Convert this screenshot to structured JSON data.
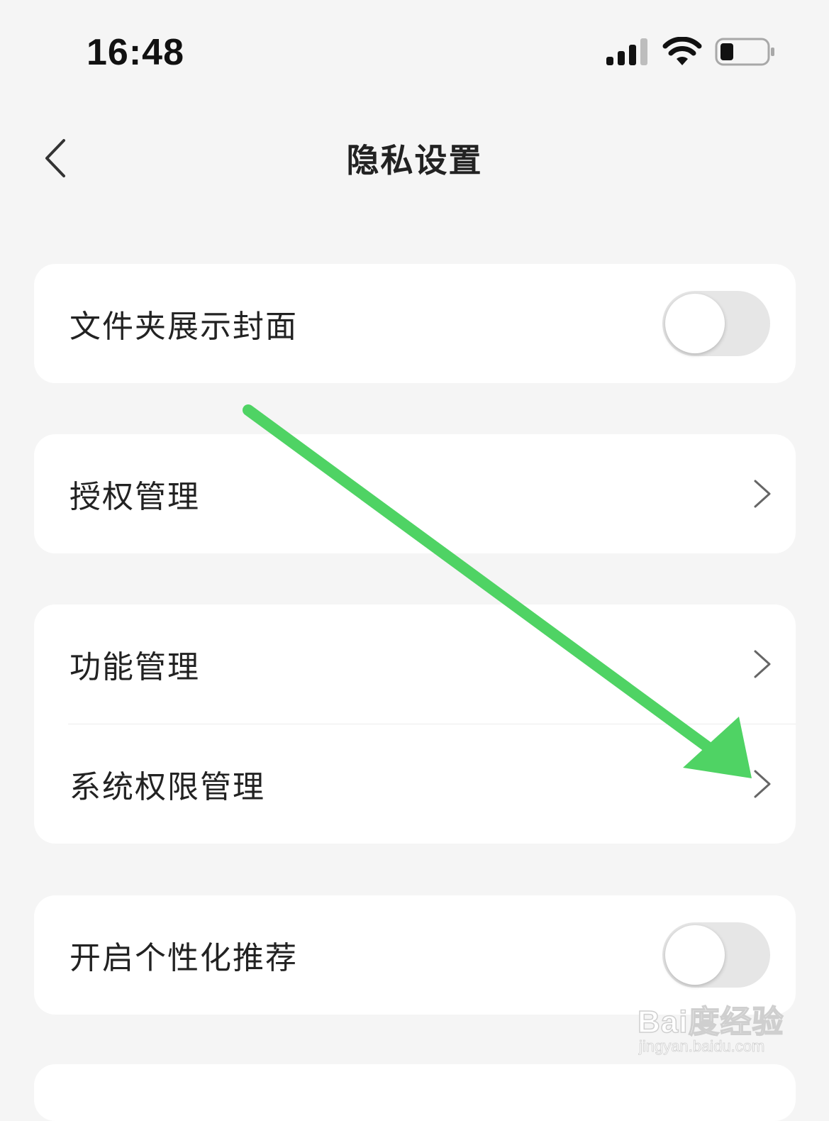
{
  "status_bar": {
    "time": "16:48",
    "icons": [
      "signal-icon",
      "wifi-icon",
      "battery-icon"
    ]
  },
  "nav": {
    "title": "隐私设置",
    "back_icon": "chevron-left-icon"
  },
  "settings": {
    "folder_cover": {
      "label": "文件夹展示封面",
      "toggle_on": false
    },
    "auth_manage": {
      "label": "授权管理",
      "icon": "chevron-right-icon"
    },
    "feature_manage": {
      "label": "功能管理",
      "icon": "chevron-right-icon"
    },
    "system_permission": {
      "label": "系统权限管理",
      "icon": "chevron-right-icon"
    },
    "personalized_recommend": {
      "label": "开启个性化推荐",
      "toggle_on": false
    }
  },
  "annotation": {
    "color": "#4fd364",
    "icon": "arrow-annotation-icon"
  },
  "watermark": {
    "main": "Bai度经验",
    "sub": "jingyan.baidu.com"
  },
  "colors": {
    "background": "#f5f5f5",
    "card": "#ffffff",
    "toggle_off": "#e6e6e6"
  }
}
